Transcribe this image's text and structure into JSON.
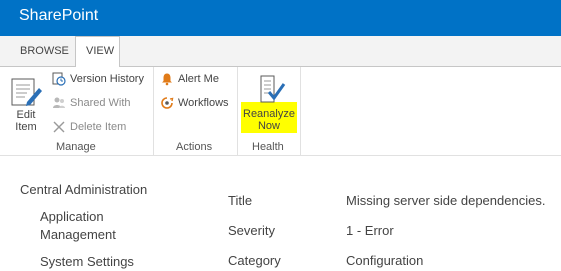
{
  "app": {
    "title": "SharePoint"
  },
  "tabs": [
    {
      "label": "BROWSE",
      "active": false
    },
    {
      "label": "VIEW",
      "active": true
    }
  ],
  "ribbon": {
    "manage": {
      "label": "Manage",
      "edit_item_line1": "Edit",
      "edit_item_line2": "Item",
      "version_history": "Version History",
      "shared_with": "Shared With",
      "delete_item": "Delete Item"
    },
    "actions": {
      "label": "Actions",
      "alert_me": "Alert Me",
      "workflows": "Workflows"
    },
    "health": {
      "label": "Health",
      "reanalyze_line1": "Reanalyze",
      "reanalyze_line2": "Now"
    }
  },
  "nav": {
    "central_admin": "Central Administration",
    "app_mgmt_line1": "Application",
    "app_mgmt_line2": "Management",
    "system_settings": "System Settings"
  },
  "fields": [
    {
      "label": "Title",
      "value": "Missing server side dependencies."
    },
    {
      "label": "Severity",
      "value": "1 - Error"
    },
    {
      "label": "Category",
      "value": "Configuration"
    }
  ],
  "colors": {
    "suite_bar": "#0072c6",
    "highlight": "#ffff00",
    "icon_blue": "#2a6fb6",
    "icon_orange": "#e07b19"
  }
}
